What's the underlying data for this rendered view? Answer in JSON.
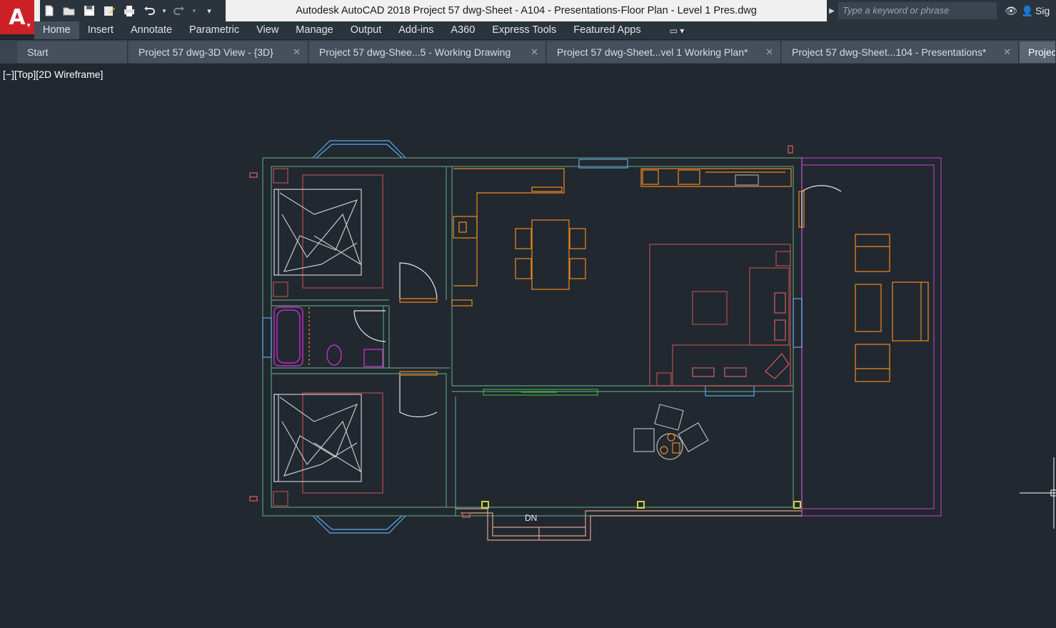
{
  "app": {
    "logo_letter": "A",
    "window_title": "Autodesk AutoCAD 2018    Project 57 dwg-Sheet - A104 - Presentations-Floor Plan - Level 1 Pres.dwg"
  },
  "quick_access": [
    "new-icon",
    "open-icon",
    "save-icon",
    "save-as-icon",
    "plot-icon",
    "undo-icon",
    "redo-icon",
    "customize-icon"
  ],
  "help": {
    "search_placeholder": "Type a keyword or phrase",
    "sign_in_label": "Sig"
  },
  "ribbon": {
    "tabs": [
      "Home",
      "Insert",
      "Annotate",
      "Parametric",
      "View",
      "Manage",
      "Output",
      "Add-ins",
      "A360",
      "Express Tools",
      "Featured Apps"
    ],
    "active_tab": "Home"
  },
  "file_tabs": [
    {
      "label": "Start"
    },
    {
      "label": "Project 57 dwg-3D View - {3D}"
    },
    {
      "label": "Project 57 dwg-Shee...5 - Working Drawing"
    },
    {
      "label": "Project 57 dwg-Sheet...vel 1 Working Plan*"
    },
    {
      "label": "Project 57 dwg-Sheet...104 - Presentations*"
    },
    {
      "label": "Projec"
    }
  ],
  "viewport": {
    "label": "[−][Top][2D Wireframe]",
    "stair_label": "DN"
  },
  "colors": {
    "background": "#212830",
    "autocad_red": "#cc2127",
    "wall_green": "#5d9a78",
    "furniture_orange": "#f08a1c",
    "room_red": "#b34f4f",
    "window_blue": "#5fa8e6",
    "bath_magenta": "#e030e0",
    "door_white": "#e8e8e8",
    "terrace_magenta": "#b040b0"
  }
}
